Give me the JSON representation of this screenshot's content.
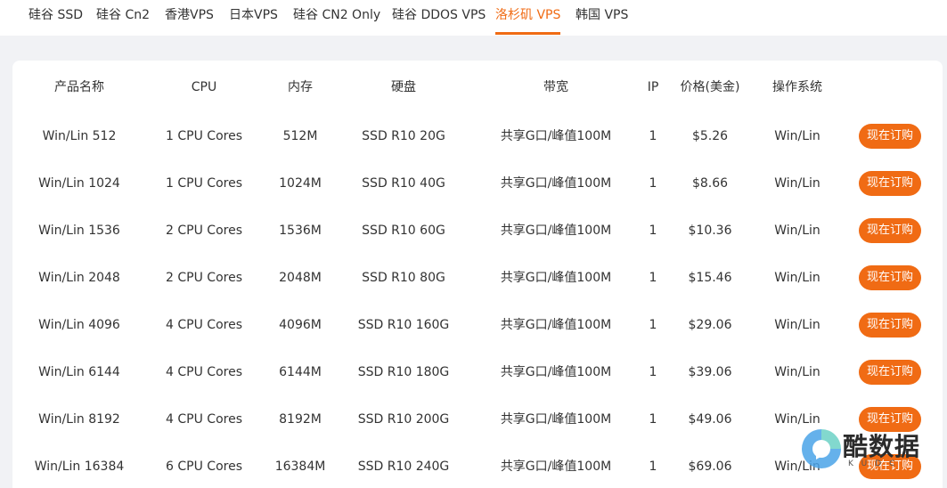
{
  "tabs": [
    {
      "label": "硅谷 SSD"
    },
    {
      "label": "硅谷 Cn2"
    },
    {
      "label": "香港VPS"
    },
    {
      "label": "日本VPS"
    },
    {
      "label": "硅谷 CN2 Only"
    },
    {
      "label": "硅谷 DDOS VPS"
    },
    {
      "label": "洛杉矶 VPS"
    },
    {
      "label": "韩国 VPS"
    }
  ],
  "active_tab": "洛杉矶 VPS",
  "colors": {
    "accent": "#f06b14",
    "page_bg": "#f1f2f5",
    "card_bg": "#ffffff"
  },
  "table": {
    "headers": [
      "产品名称",
      "CPU",
      "内存",
      "硬盘",
      "带宽",
      "IP",
      "价格(美金)",
      "操作系统"
    ],
    "buy_label": "现在订购",
    "rows": [
      {
        "name": "Win/Lin 512",
        "cpu": "1 CPU Cores",
        "ram": "512M",
        "disk": "SSD R10 20G",
        "bw": "共享G口/峰值100M",
        "ip": "1",
        "price": "$5.26",
        "os": "Win/Lin"
      },
      {
        "name": "Win/Lin 1024",
        "cpu": "1 CPU Cores",
        "ram": "1024M",
        "disk": "SSD R10 40G",
        "bw": "共享G口/峰值100M",
        "ip": "1",
        "price": "$8.66",
        "os": "Win/Lin"
      },
      {
        "name": "Win/Lin 1536",
        "cpu": "2 CPU Cores",
        "ram": "1536M",
        "disk": "SSD R10 60G",
        "bw": "共享G口/峰值100M",
        "ip": "1",
        "price": "$10.36",
        "os": "Win/Lin"
      },
      {
        "name": "Win/Lin 2048",
        "cpu": "2 CPU Cores",
        "ram": "2048M",
        "disk": "SSD R10 80G",
        "bw": "共享G口/峰值100M",
        "ip": "1",
        "price": "$15.46",
        "os": "Win/Lin"
      },
      {
        "name": "Win/Lin 4096",
        "cpu": "4 CPU Cores",
        "ram": "4096M",
        "disk": "SSD R10 160G",
        "bw": "共享G口/峰值100M",
        "ip": "1",
        "price": "$29.06",
        "os": "Win/Lin"
      },
      {
        "name": "Win/Lin 6144",
        "cpu": "4 CPU Cores",
        "ram": "6144M",
        "disk": "SSD R10 180G",
        "bw": "共享G口/峰值100M",
        "ip": "1",
        "price": "$39.06",
        "os": "Win/Lin"
      },
      {
        "name": "Win/Lin 8192",
        "cpu": "4 CPU Cores",
        "ram": "8192M",
        "disk": "SSD R10 200G",
        "bw": "共享G口/峰值100M",
        "ip": "1",
        "price": "$49.06",
        "os": "Win/Lin"
      },
      {
        "name": "Win/Lin 16384",
        "cpu": "6 CPU Cores",
        "ram": "16384M",
        "disk": "SSD R10 240G",
        "bw": "共享G口/峰值100M",
        "ip": "1",
        "price": "$69.06",
        "os": "Win/Lin"
      }
    ]
  },
  "watermark": {
    "text": "酷数据",
    "sub": "KUDC",
    "icon": "kudc-logo-icon"
  }
}
